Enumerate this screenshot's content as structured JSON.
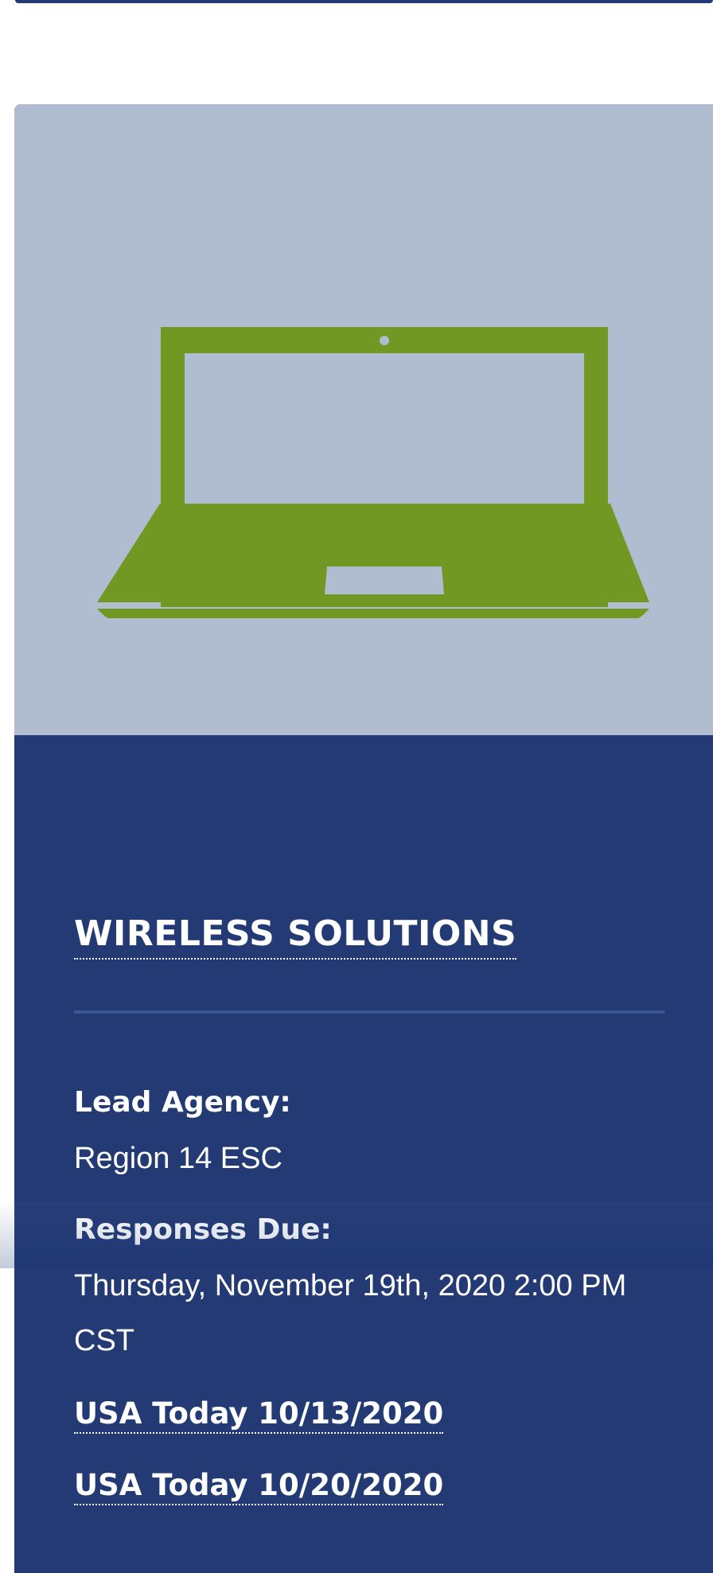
{
  "card": {
    "title": "WIRELESS SOLUTIONS",
    "image_icon": "laptop-icon",
    "fields": [
      {
        "label": "Lead Agency:",
        "value": "Region 14 ESC"
      },
      {
        "label": "Responses Due:",
        "value": "Thursday, November 19th, 2020 2:00 PM CST"
      }
    ],
    "links": [
      {
        "label": "USA Today 10/13/2020"
      },
      {
        "label": "USA Today 10/20/2020"
      }
    ]
  },
  "colors": {
    "card_background": "#233a75",
    "image_background": "#b0bccf",
    "laptop_green": "#709822",
    "text": "#ffffff",
    "divider": "#3c5596"
  }
}
